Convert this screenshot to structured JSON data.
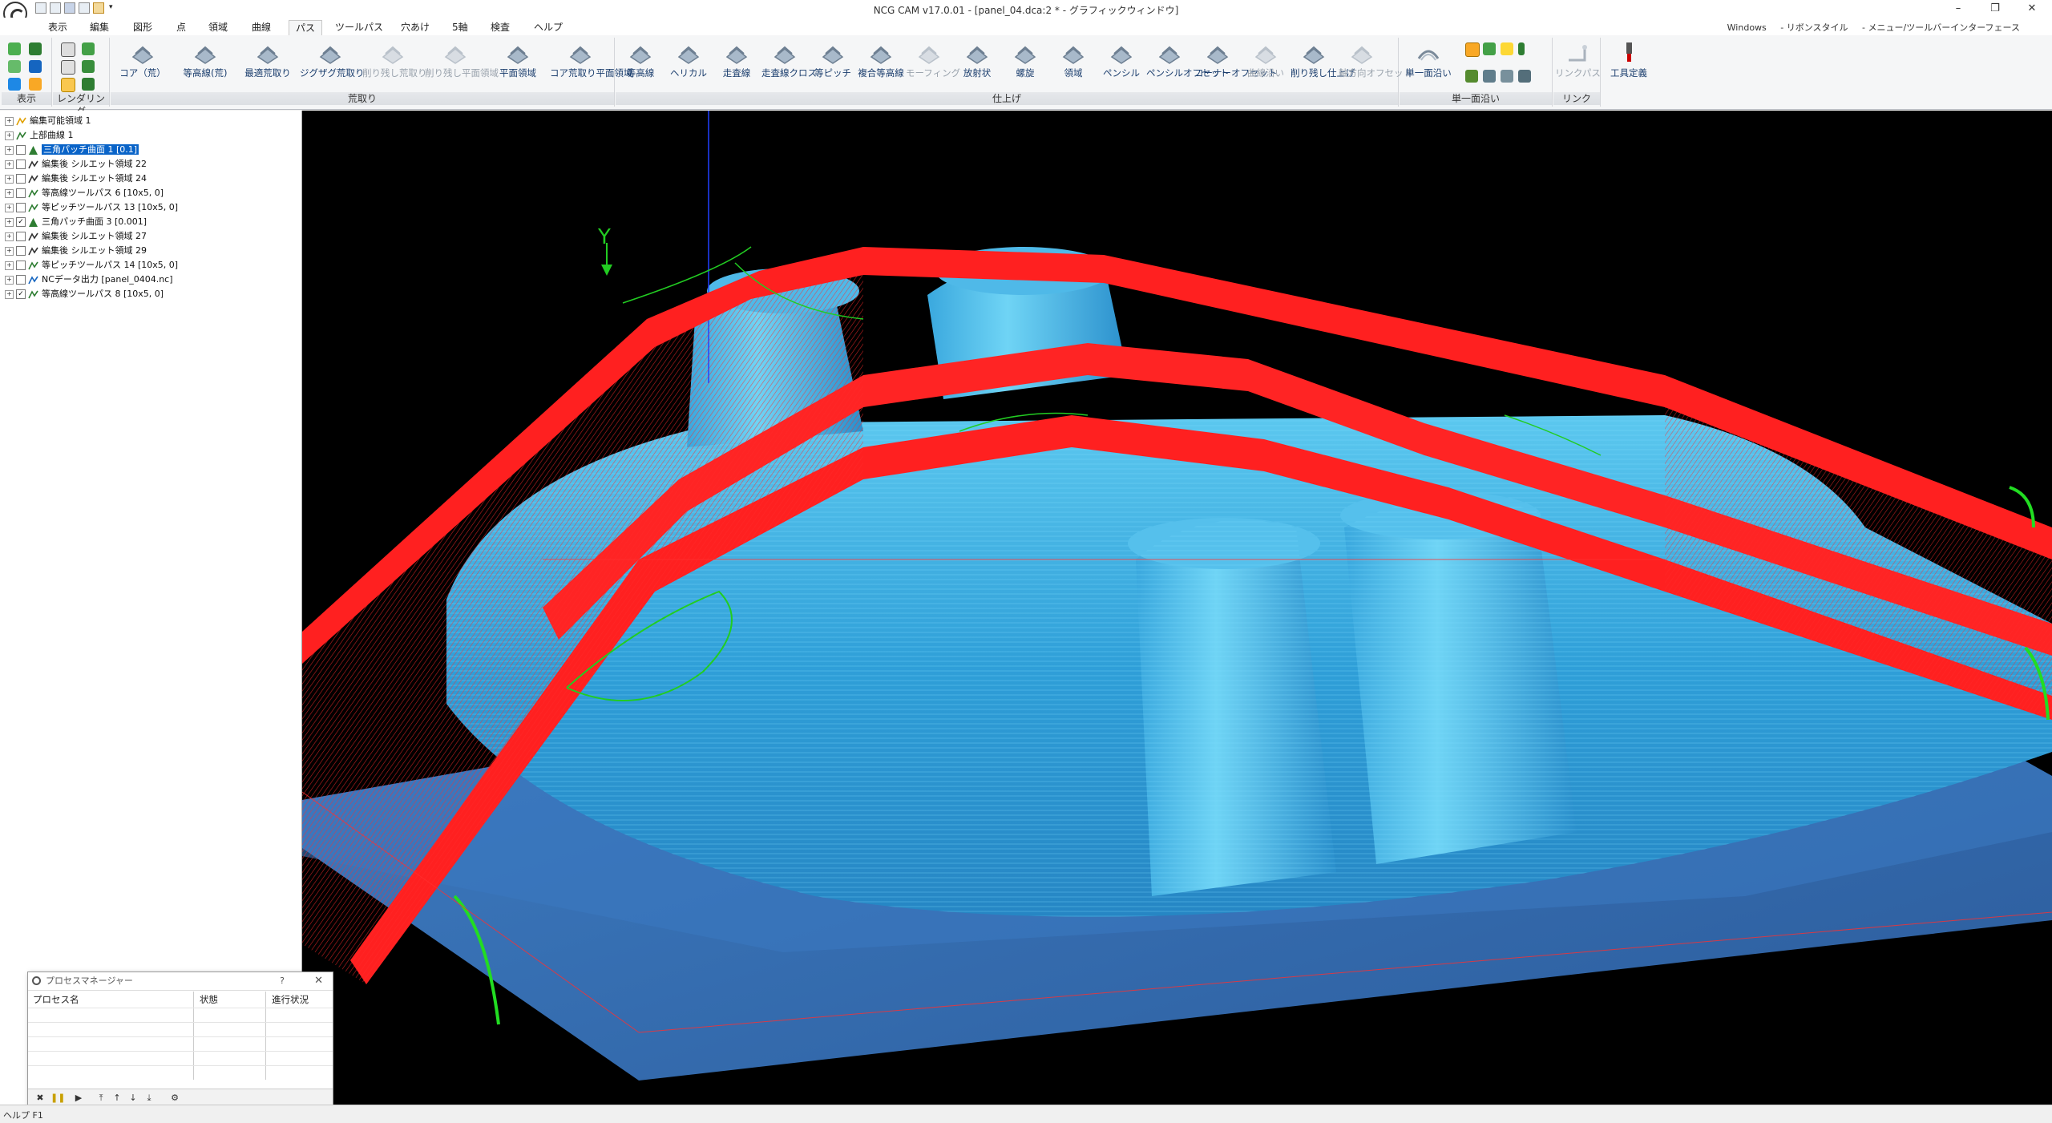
{
  "window": {
    "title": "NCG CAM v17.0.01 - [panel_04.dca:2 * - グラフィックウィンドウ]",
    "controls": {
      "minimize": "–",
      "maximize": "❐",
      "close": "✕"
    }
  },
  "menu": {
    "tabs": [
      "表示",
      "編集",
      "図形",
      "点",
      "領域",
      "曲線",
      "パス",
      "ツールパス",
      "穴あけ",
      "5軸",
      "検査",
      "ヘルプ"
    ],
    "active_tab": "パス",
    "right": [
      "Windows",
      "- リボンスタイル",
      "- メニュー/ツールバーインターフェース"
    ]
  },
  "ribbon": {
    "groups": {
      "display": "表示",
      "render": "レンダリング",
      "rough": "荒取り",
      "finish": "仕上げ",
      "single": "単一面沿い",
      "link": "リンク"
    },
    "rough_buttons": [
      "コア（荒）",
      "等高線(荒)",
      "最適荒取り",
      "ジグザグ荒取り",
      "削り残し荒取り",
      "削り残し平面領域",
      "平面領域",
      "コア荒取り平面領域"
    ],
    "rough_disabled": [
      false,
      false,
      false,
      false,
      true,
      true,
      false,
      false
    ],
    "finish_buttons": [
      "等高線",
      "ヘリカル",
      "走査線",
      "走査線クロス",
      "等ピッチ",
      "複合等高線",
      "モーフィング",
      "放射状",
      "螺旋",
      "領域",
      "ペンシル",
      "ペンシルオフセット",
      "コーナーオフセット",
      "曲線沿い",
      "削り残し仕上げ",
      "軸方向オフセット"
    ],
    "finish_disabled": [
      false,
      false,
      false,
      false,
      false,
      false,
      true,
      false,
      false,
      false,
      false,
      false,
      false,
      true,
      false,
      true
    ],
    "single_button": "単一面沿い",
    "link_button": "リンクパス",
    "tool_button": "工具定義"
  },
  "tree": {
    "items": [
      {
        "label": "編集可能領域 1",
        "icon": "region-icon",
        "checkbox": false,
        "checked": false,
        "selected": false
      },
      {
        "label": "上部曲線 1",
        "icon": "curve-icon",
        "checkbox": false,
        "checked": false,
        "selected": false
      },
      {
        "label": "三角パッチ曲面 1 [0.1]",
        "icon": "triangle-icon",
        "checkbox": true,
        "checked": false,
        "selected": true
      },
      {
        "label": "編集後 シルエット領域 22",
        "icon": "silhouette-icon",
        "checkbox": true,
        "checked": false,
        "selected": false
      },
      {
        "label": "編集後 シルエット領域 24",
        "icon": "silhouette-icon",
        "checkbox": true,
        "checked": false,
        "selected": false
      },
      {
        "label": "等高線ツールパス 6 [10x5, 0]",
        "icon": "toolpath-icon",
        "checkbox": true,
        "checked": false,
        "selected": false
      },
      {
        "label": "等ピッチツールパス 13 [10x5, 0]",
        "icon": "toolpath-icon",
        "checkbox": true,
        "checked": false,
        "selected": false
      },
      {
        "label": "三角パッチ曲面 3 [0.001]",
        "icon": "triangle-icon",
        "checkbox": true,
        "checked": true,
        "selected": false
      },
      {
        "label": "編集後 シルエット領域 27",
        "icon": "silhouette-icon",
        "checkbox": true,
        "checked": false,
        "selected": false
      },
      {
        "label": "編集後 シルエット領域 29",
        "icon": "silhouette-icon",
        "checkbox": true,
        "checked": false,
        "selected": false
      },
      {
        "label": "等ピッチツールパス 14 [10x5, 0]",
        "icon": "toolpath-icon",
        "checkbox": true,
        "checked": false,
        "selected": false
      },
      {
        "label": "NCデータ出力 [panel_0404.nc]",
        "icon": "nc-output-icon",
        "checkbox": true,
        "checked": false,
        "selected": false
      },
      {
        "label": "等高線ツールパス 8 [10x5, 0]",
        "icon": "toolpath-icon",
        "checkbox": true,
        "checked": true,
        "selected": false
      }
    ]
  },
  "viewport": {
    "axis_label": "Y"
  },
  "process_manager": {
    "title": "プロセスマネージャー",
    "help": "?",
    "close": "✕",
    "columns": [
      "プロセス名",
      "状態",
      "進行状況"
    ]
  },
  "status": {
    "text": "ヘルプ F1"
  },
  "colors": {
    "surface": "#2a9fd6",
    "toolpath_red": "#ff2020",
    "toolpath_green": "#22dd22",
    "viewport_bg": "#000000"
  }
}
